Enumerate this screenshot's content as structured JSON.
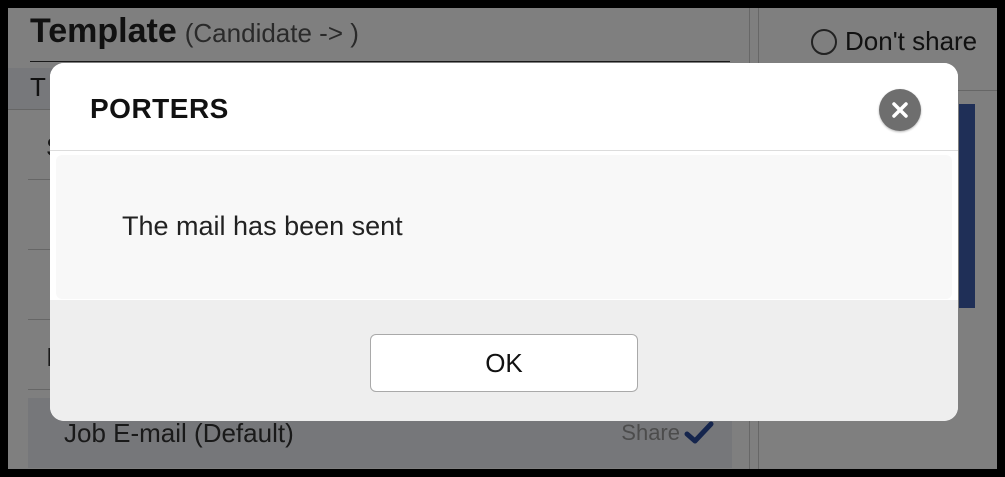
{
  "background": {
    "template_title": "Template",
    "template_subtitle": "(Candidate -> )",
    "tab_label": "T",
    "rows": [
      "S",
      "",
      "",
      "I"
    ],
    "selected_row": {
      "label": "Job E-mail (Default)",
      "share_label": "Share",
      "share_icon": "check-icon"
    },
    "dont_share_label": "Don't share"
  },
  "dialog": {
    "title": "PORTERS",
    "message": "The mail has been sent",
    "ok_label": "OK",
    "close_icon": "close-icon"
  },
  "colors": {
    "overlay": "rgba(0,0,0,0.5)",
    "close_button": "#6e6e6e",
    "accent_bar": "#3f5fae",
    "check": "#2b4a9a"
  }
}
